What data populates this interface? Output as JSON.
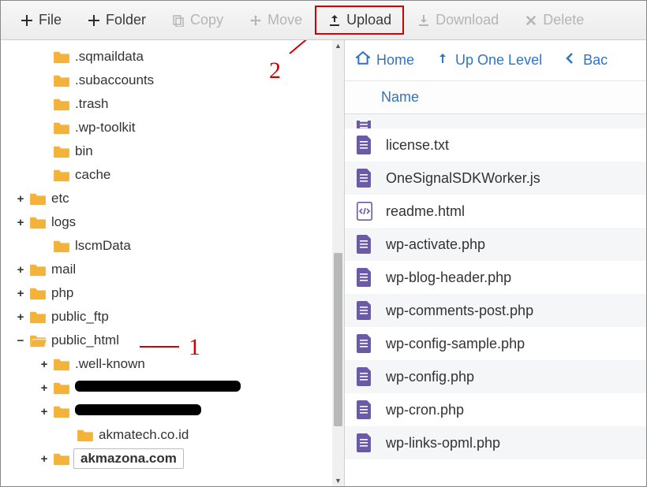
{
  "toolbar": {
    "file": {
      "label": "File",
      "disabled": false
    },
    "folder": {
      "label": "Folder",
      "disabled": false
    },
    "copy": {
      "label": "Copy",
      "disabled": true
    },
    "move": {
      "label": "Move",
      "disabled": true
    },
    "upload": {
      "label": "Upload",
      "disabled": false,
      "highlighted": true
    },
    "download": {
      "label": "Download",
      "disabled": true
    },
    "delete": {
      "label": "Delete",
      "disabled": true
    }
  },
  "annotations": {
    "one": "1",
    "two": "2"
  },
  "tree": [
    {
      "indent": 1,
      "expander": "",
      "open": false,
      "label": ".sqmaildata"
    },
    {
      "indent": 1,
      "expander": "",
      "open": false,
      "label": ".subaccounts"
    },
    {
      "indent": 1,
      "expander": "",
      "open": false,
      "label": ".trash"
    },
    {
      "indent": 1,
      "expander": "",
      "open": false,
      "label": ".wp-toolkit"
    },
    {
      "indent": 1,
      "expander": "",
      "open": false,
      "label": "bin"
    },
    {
      "indent": 1,
      "expander": "",
      "open": false,
      "label": "cache"
    },
    {
      "indent": 0,
      "expander": "+",
      "open": false,
      "label": "etc"
    },
    {
      "indent": 0,
      "expander": "+",
      "open": false,
      "label": "logs"
    },
    {
      "indent": 1,
      "expander": "",
      "open": false,
      "label": "lscmData"
    },
    {
      "indent": 0,
      "expander": "+",
      "open": false,
      "label": "mail"
    },
    {
      "indent": 0,
      "expander": "+",
      "open": false,
      "label": "php"
    },
    {
      "indent": 0,
      "expander": "+",
      "open": false,
      "label": "public_ftp"
    },
    {
      "indent": 0,
      "expander": "−",
      "open": true,
      "label": "public_html"
    },
    {
      "indent": 1,
      "expander": "+",
      "open": false,
      "label": ".well-known"
    },
    {
      "indent": 1,
      "expander": "+",
      "open": false,
      "label": "",
      "redacted": true,
      "redactWidth": 210
    },
    {
      "indent": 1,
      "expander": "+",
      "open": false,
      "label": "",
      "redacted": true,
      "redactWidth": 160
    },
    {
      "indent": 2,
      "expander": "",
      "open": false,
      "label": "akmatech.co.id"
    },
    {
      "indent": 1,
      "expander": "+",
      "open": false,
      "label": "akmazona.com",
      "selected": true
    }
  ],
  "crumbs": {
    "home": "Home",
    "up": "Up One Level",
    "back": "Bac"
  },
  "columnHeader": {
    "name": "Name"
  },
  "files": [
    {
      "icon": "file",
      "name": ""
    },
    {
      "icon": "file",
      "name": "license.txt"
    },
    {
      "icon": "file",
      "name": "OneSignalSDKWorker.js"
    },
    {
      "icon": "code",
      "name": "readme.html"
    },
    {
      "icon": "file",
      "name": "wp-activate.php"
    },
    {
      "icon": "file",
      "name": "wp-blog-header.php"
    },
    {
      "icon": "file",
      "name": "wp-comments-post.php"
    },
    {
      "icon": "file",
      "name": "wp-config-sample.php"
    },
    {
      "icon": "file",
      "name": "wp-config.php"
    },
    {
      "icon": "file",
      "name": "wp-cron.php"
    },
    {
      "icon": "file",
      "name": "wp-links-opml.php"
    }
  ]
}
